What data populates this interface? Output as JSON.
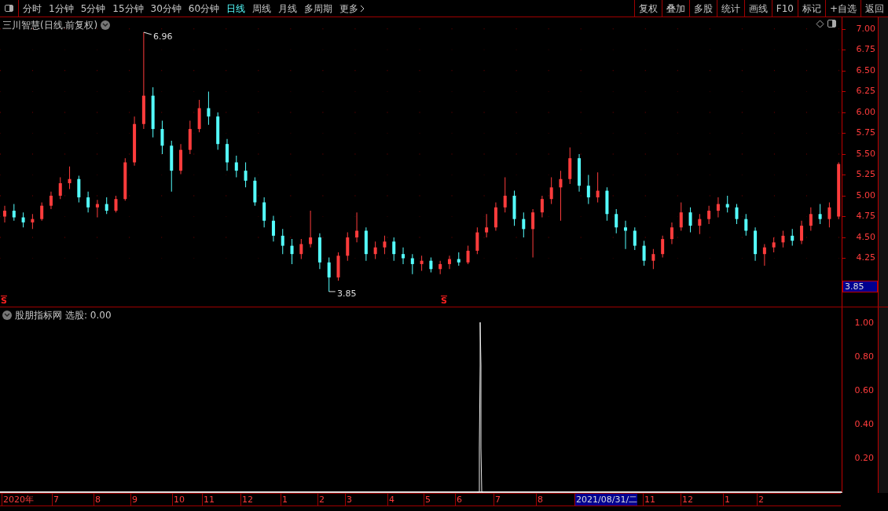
{
  "toolbar": {
    "periods": [
      {
        "label": "分时",
        "selected": false
      },
      {
        "label": "1分钟",
        "selected": false
      },
      {
        "label": "5分钟",
        "selected": false
      },
      {
        "label": "15分钟",
        "selected": false
      },
      {
        "label": "30分钟",
        "selected": false
      },
      {
        "label": "60分钟",
        "selected": false
      },
      {
        "label": "日线",
        "selected": true
      },
      {
        "label": "周线",
        "selected": false
      },
      {
        "label": "月线",
        "selected": false
      },
      {
        "label": "多周期",
        "selected": false
      }
    ],
    "more": "更多",
    "buttons": [
      "复权",
      "叠加",
      "多股",
      "统计",
      "画线",
      "F10",
      "标记",
      "+自选",
      "返回"
    ]
  },
  "price_chart": {
    "title": "三川智慧(日线.前复权)",
    "high_label": "6.96",
    "low_label": "3.85",
    "signal_markers": [
      "S",
      "S"
    ],
    "current_price": "3.85",
    "chart_data": {
      "type": "candlestick",
      "ylim": [
        3.67,
        7.14
      ],
      "grid": true,
      "yticks": [
        {
          "value": 7.0,
          "label": "7.00"
        },
        {
          "value": 6.75,
          "label": "6.75"
        },
        {
          "value": 6.5,
          "label": "6.50"
        },
        {
          "value": 6.25,
          "label": "6.25"
        },
        {
          "value": 6.0,
          "label": "6.00"
        },
        {
          "value": 5.75,
          "label": "5.75"
        },
        {
          "value": 5.5,
          "label": "5.50"
        },
        {
          "value": 5.25,
          "label": "5.25"
        },
        {
          "value": 5.0,
          "label": "5.00"
        },
        {
          "value": 4.75,
          "label": "4.75"
        },
        {
          "value": 4.5,
          "label": "4.50"
        },
        {
          "value": 4.25,
          "label": "4.25"
        }
      ],
      "ohlc": [
        [
          4.75,
          4.88,
          4.68,
          4.82
        ],
        [
          4.82,
          4.9,
          4.7,
          4.74
        ],
        [
          4.74,
          4.8,
          4.62,
          4.68
        ],
        [
          4.68,
          4.78,
          4.6,
          4.72
        ],
        [
          4.72,
          4.92,
          4.7,
          4.88
        ],
        [
          4.88,
          5.05,
          4.84,
          5.0
        ],
        [
          5.0,
          5.22,
          4.96,
          5.15
        ],
        [
          5.15,
          5.35,
          5.08,
          5.2
        ],
        [
          5.2,
          5.24,
          4.92,
          4.98
        ],
        [
          4.98,
          5.05,
          4.8,
          4.86
        ],
        [
          4.86,
          4.95,
          4.74,
          4.9
        ],
        [
          4.9,
          4.98,
          4.78,
          4.82
        ],
        [
          4.82,
          5.0,
          4.8,
          4.96
        ],
        [
          4.96,
          5.45,
          4.94,
          5.4
        ],
        [
          5.4,
          5.95,
          5.36,
          5.86
        ],
        [
          5.86,
          6.96,
          5.8,
          6.2
        ],
        [
          6.2,
          6.3,
          5.7,
          5.8
        ],
        [
          5.8,
          5.9,
          5.5,
          5.6
        ],
        [
          5.6,
          5.66,
          5.05,
          5.3
        ],
        [
          5.3,
          5.62,
          5.26,
          5.55
        ],
        [
          5.55,
          5.9,
          5.5,
          5.8
        ],
        [
          5.8,
          6.15,
          5.76,
          6.05
        ],
        [
          6.05,
          6.25,
          5.85,
          5.95
        ],
        [
          5.95,
          6.0,
          5.55,
          5.62
        ],
        [
          5.62,
          5.68,
          5.3,
          5.4
        ],
        [
          5.4,
          5.48,
          5.22,
          5.3
        ],
        [
          5.3,
          5.4,
          5.1,
          5.18
        ],
        [
          5.18,
          5.22,
          4.88,
          4.92
        ],
        [
          4.92,
          4.98,
          4.62,
          4.7
        ],
        [
          4.7,
          4.76,
          4.45,
          4.52
        ],
        [
          4.52,
          4.6,
          4.3,
          4.4
        ],
        [
          4.4,
          4.48,
          4.18,
          4.3
        ],
        [
          4.3,
          4.48,
          4.24,
          4.42
        ],
        [
          4.42,
          4.82,
          4.38,
          4.5
        ],
        [
          4.5,
          4.55,
          4.12,
          4.2
        ],
        [
          4.2,
          4.26,
          3.85,
          4.02
        ],
        [
          4.02,
          4.32,
          3.98,
          4.28
        ],
        [
          4.28,
          4.56,
          4.22,
          4.5
        ],
        [
          4.5,
          4.8,
          4.44,
          4.58
        ],
        [
          4.58,
          4.62,
          4.22,
          4.3
        ],
        [
          4.3,
          4.45,
          4.24,
          4.38
        ],
        [
          4.38,
          4.52,
          4.3,
          4.45
        ],
        [
          4.45,
          4.5,
          4.22,
          4.3
        ],
        [
          4.3,
          4.38,
          4.18,
          4.25
        ],
        [
          4.25,
          4.3,
          4.06,
          4.18
        ],
        [
          4.18,
          4.28,
          4.1,
          4.22
        ],
        [
          4.22,
          4.26,
          4.08,
          4.12
        ],
        [
          4.12,
          4.22,
          4.06,
          4.18
        ],
        [
          4.18,
          4.28,
          4.12,
          4.24
        ],
        [
          4.24,
          4.32,
          4.16,
          4.2
        ],
        [
          4.2,
          4.4,
          4.18,
          4.34
        ],
        [
          4.34,
          4.62,
          4.3,
          4.56
        ],
        [
          4.56,
          4.78,
          4.5,
          4.62
        ],
        [
          4.62,
          4.92,
          4.58,
          4.86
        ],
        [
          4.86,
          5.22,
          4.8,
          5.0
        ],
        [
          5.0,
          5.06,
          4.64,
          4.72
        ],
        [
          4.72,
          4.8,
          4.5,
          4.6
        ],
        [
          4.6,
          4.84,
          4.26,
          4.8
        ],
        [
          4.8,
          5.0,
          4.74,
          4.96
        ],
        [
          4.96,
          5.22,
          4.9,
          5.1
        ],
        [
          5.1,
          5.3,
          4.7,
          5.2
        ],
        [
          5.2,
          5.58,
          5.14,
          5.45
        ],
        [
          5.45,
          5.5,
          5.05,
          5.12
        ],
        [
          5.12,
          5.25,
          4.9,
          4.98
        ],
        [
          4.98,
          5.28,
          4.92,
          5.06
        ],
        [
          5.06,
          5.1,
          4.7,
          4.78
        ],
        [
          4.78,
          4.84,
          4.55,
          4.62
        ],
        [
          4.62,
          4.7,
          4.36,
          4.58
        ],
        [
          4.58,
          4.62,
          4.35,
          4.4
        ],
        [
          4.4,
          4.46,
          4.16,
          4.22
        ],
        [
          4.22,
          4.36,
          4.12,
          4.3
        ],
        [
          4.3,
          4.52,
          4.26,
          4.48
        ],
        [
          4.48,
          4.68,
          4.42,
          4.62
        ],
        [
          4.62,
          4.92,
          4.58,
          4.8
        ],
        [
          4.8,
          4.86,
          4.56,
          4.64
        ],
        [
          4.64,
          4.78,
          4.54,
          4.72
        ],
        [
          4.72,
          4.88,
          4.66,
          4.82
        ],
        [
          4.82,
          4.98,
          4.74,
          4.9
        ],
        [
          4.9,
          5.0,
          4.8,
          4.86
        ],
        [
          4.86,
          4.9,
          4.66,
          4.72
        ],
        [
          4.72,
          4.78,
          4.52,
          4.58
        ],
        [
          4.58,
          4.62,
          4.22,
          4.3
        ],
        [
          4.3,
          4.42,
          4.16,
          4.38
        ],
        [
          4.38,
          4.5,
          4.32,
          4.44
        ],
        [
          4.44,
          4.58,
          4.38,
          4.52
        ],
        [
          4.52,
          4.6,
          4.4,
          4.46
        ],
        [
          4.46,
          4.7,
          4.42,
          4.64
        ],
        [
          4.64,
          4.86,
          4.58,
          4.78
        ],
        [
          4.78,
          4.9,
          4.66,
          4.72
        ],
        [
          4.72,
          4.92,
          4.62,
          4.86
        ],
        [
          4.75,
          5.4,
          4.72,
          5.38
        ]
      ]
    }
  },
  "indicator": {
    "name": "股朋指标网",
    "value": "选股: 0.00",
    "axis_labels": [
      "1.00",
      "0.80",
      "0.60",
      "0.40",
      "0.20"
    ]
  },
  "time_axis": {
    "labels": [
      "2020年",
      "7",
      "8",
      "9",
      "10",
      "11",
      "12",
      "1",
      "2",
      "3",
      "4",
      "5",
      "6",
      "7",
      "8",
      "2021/08/31/二",
      "11",
      "12",
      "1",
      "2"
    ]
  }
}
